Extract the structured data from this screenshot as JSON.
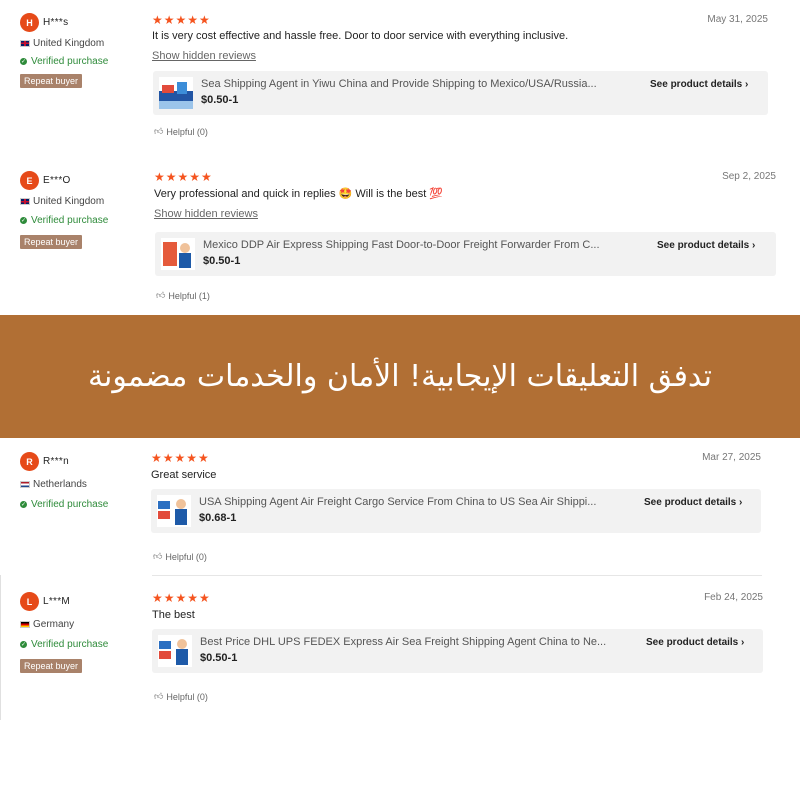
{
  "banner": {
    "text": "تدفق التعليقات الإيجابية! الأمان والخدمات مضمونة"
  },
  "verified_label": "Verified purchase",
  "repeat_label": "Repeat buyer",
  "hidden_reviews_label": "Show hidden reviews",
  "see_details_label": "See product details",
  "stars": "★★★★★",
  "colors": {
    "avatar": "#e64a19",
    "stars": "#f5541f",
    "verified": "#2e8b3a",
    "repeat_badge": "#a9826a",
    "banner": "#b16f34"
  },
  "reviews": [
    {
      "initial": "H",
      "name": "H***s",
      "country": "United Kingdom",
      "flag": "flag-uk",
      "date": "May 31, 2025",
      "rating": 5,
      "comment": "It is very cost effective and hassle free. Door to door service with everything inclusive.",
      "product_title": "Sea Shipping Agent in Yiwu China and Provide Shipping to Mexico/USA/Russia...",
      "price": "$0.50-1",
      "helpful": "Helpful (0)"
    },
    {
      "initial": "E",
      "name": "E***O",
      "country": "United Kingdom",
      "flag": "flag-uk",
      "date": "Sep 2, 2025",
      "rating": 5,
      "comment": "Very professional and quick in replies 🤩  Will is the best 💯",
      "product_title": "Mexico DDP Air Express Shipping Fast Door-to-Door Freight Forwarder From C...",
      "price": "$0.50-1",
      "helpful": "Helpful (1)"
    },
    {
      "initial": "R",
      "name": "R***n",
      "country": "Netherlands",
      "flag": "flag-nl",
      "date": "Mar 27, 2025",
      "rating": 5,
      "comment": "Great service",
      "product_title": "USA Shipping Agent Air Freight Cargo Service From China to US Sea Air Shippi...",
      "price": "$0.68-1",
      "helpful": "Helpful (0)"
    },
    {
      "initial": "L",
      "name": "L***M",
      "country": "Germany",
      "flag": "flag-de",
      "date": "Feb 24, 2025",
      "rating": 5,
      "comment": "The best",
      "product_title": "Best Price DHL UPS FEDEX Express Air Sea Freight Shipping Agent China to Ne...",
      "price": "$0.50-1",
      "helpful": "Helpful (0)"
    }
  ]
}
